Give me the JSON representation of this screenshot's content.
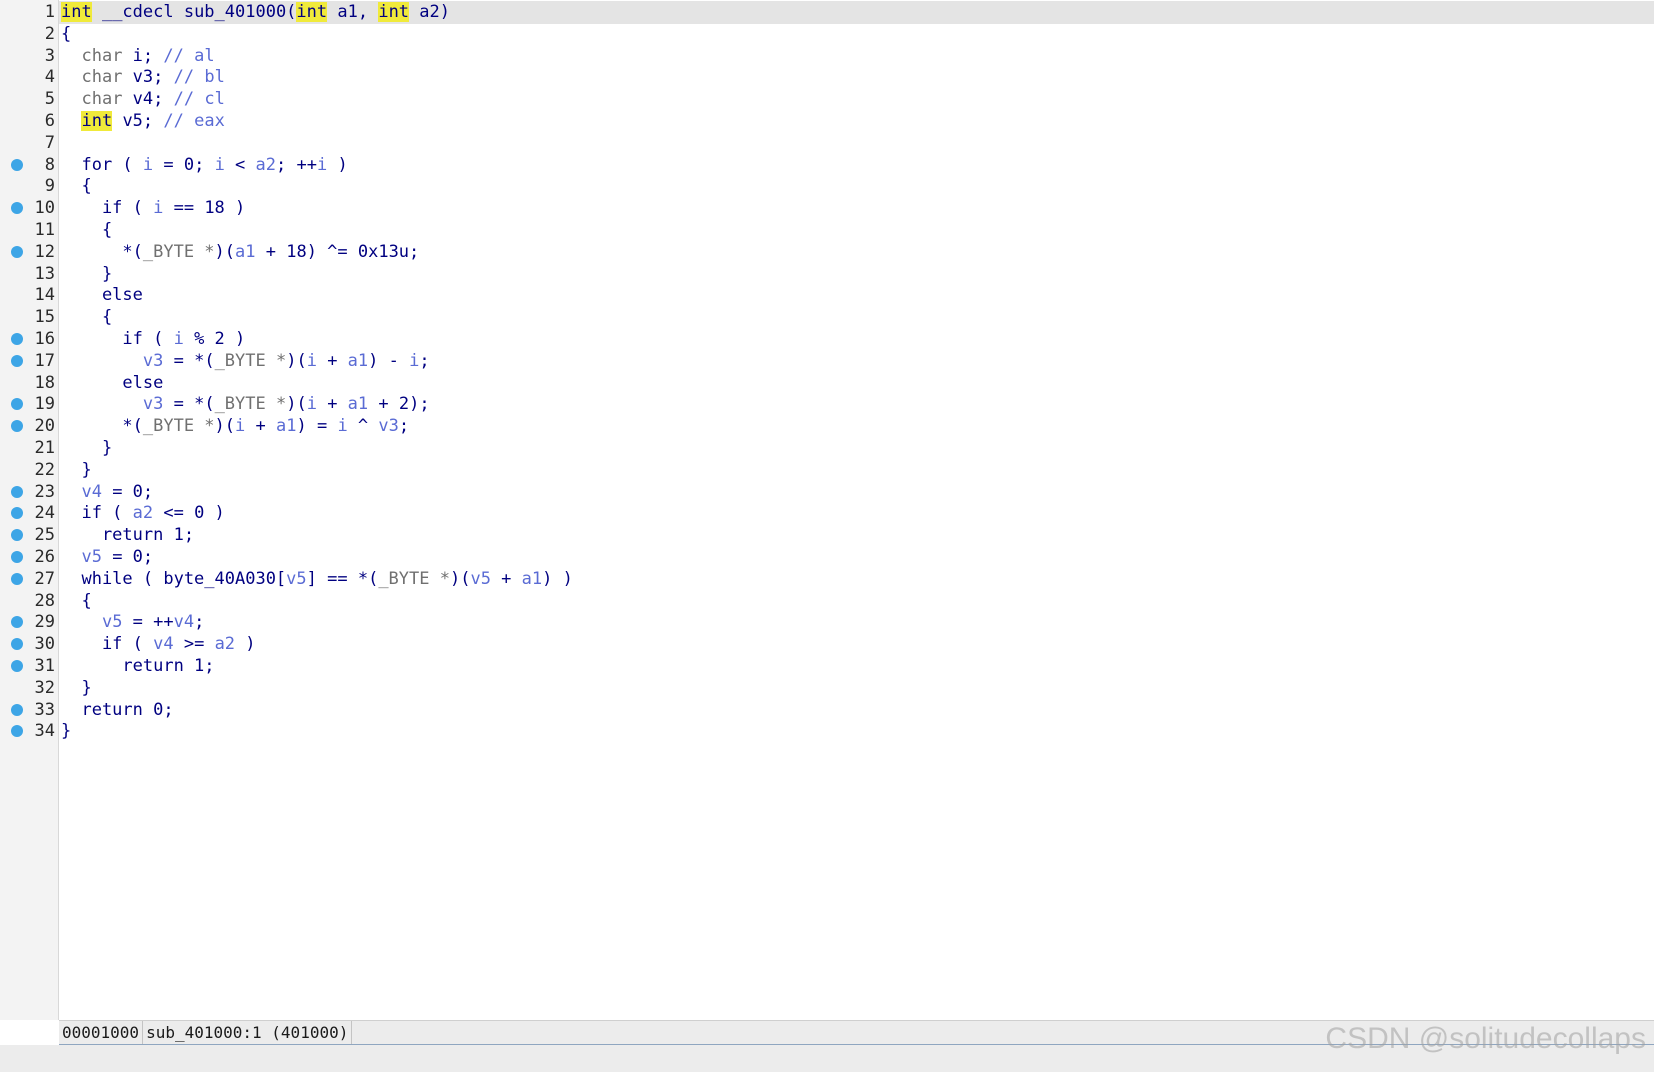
{
  "editor": {
    "current_line": 1,
    "lines": [
      {
        "n": "1",
        "bp": false,
        "tokens": [
          [
            "hl",
            "int"
          ],
          [
            "p",
            " __cdecl sub_401000("
          ],
          [
            "hl",
            "int"
          ],
          [
            "p",
            " a1, "
          ],
          [
            "hl",
            "int"
          ],
          [
            "p",
            " a2)"
          ]
        ]
      },
      {
        "n": "2",
        "bp": false,
        "tokens": [
          [
            "p",
            "{"
          ]
        ]
      },
      {
        "n": "3",
        "bp": false,
        "tokens": [
          [
            "p",
            "  "
          ],
          [
            "g",
            "char"
          ],
          [
            "p",
            " i; "
          ],
          [
            "c",
            "// al"
          ]
        ]
      },
      {
        "n": "4",
        "bp": false,
        "tokens": [
          [
            "p",
            "  "
          ],
          [
            "g",
            "char"
          ],
          [
            "p",
            " v3; "
          ],
          [
            "c",
            "// bl"
          ]
        ]
      },
      {
        "n": "5",
        "bp": false,
        "tokens": [
          [
            "p",
            "  "
          ],
          [
            "g",
            "char"
          ],
          [
            "p",
            " v4; "
          ],
          [
            "c",
            "// cl"
          ]
        ]
      },
      {
        "n": "6",
        "bp": false,
        "tokens": [
          [
            "p",
            "  "
          ],
          [
            "hl",
            "int"
          ],
          [
            "p",
            " v5; "
          ],
          [
            "c",
            "// eax"
          ]
        ]
      },
      {
        "n": "7",
        "bp": false,
        "tokens": [
          [
            "p",
            ""
          ]
        ]
      },
      {
        "n": "8",
        "bp": true,
        "tokens": [
          [
            "p",
            "  for ( "
          ],
          [
            "v",
            "i"
          ],
          [
            "p",
            " = 0; "
          ],
          [
            "v",
            "i"
          ],
          [
            "p",
            " < "
          ],
          [
            "v",
            "a2"
          ],
          [
            "p",
            "; ++"
          ],
          [
            "v",
            "i"
          ],
          [
            "p",
            " )"
          ]
        ]
      },
      {
        "n": "9",
        "bp": false,
        "tokens": [
          [
            "p",
            "  {"
          ]
        ]
      },
      {
        "n": "10",
        "bp": true,
        "tokens": [
          [
            "p",
            "    if ( "
          ],
          [
            "v",
            "i"
          ],
          [
            "p",
            " == 18 )"
          ]
        ]
      },
      {
        "n": "11",
        "bp": false,
        "tokens": [
          [
            "p",
            "    {"
          ]
        ]
      },
      {
        "n": "12",
        "bp": true,
        "tokens": [
          [
            "p",
            "      *("
          ],
          [
            "g",
            "_BYTE *"
          ],
          [
            "p",
            ")("
          ],
          [
            "v",
            "a1"
          ],
          [
            "p",
            " + 18) ^= 0x13u;"
          ]
        ]
      },
      {
        "n": "13",
        "bp": false,
        "tokens": [
          [
            "p",
            "    }"
          ]
        ]
      },
      {
        "n": "14",
        "bp": false,
        "tokens": [
          [
            "p",
            "    else"
          ]
        ]
      },
      {
        "n": "15",
        "bp": false,
        "tokens": [
          [
            "p",
            "    {"
          ]
        ]
      },
      {
        "n": "16",
        "bp": true,
        "tokens": [
          [
            "p",
            "      if ( "
          ],
          [
            "v",
            "i"
          ],
          [
            "p",
            " % 2 )"
          ]
        ]
      },
      {
        "n": "17",
        "bp": true,
        "tokens": [
          [
            "p",
            "        "
          ],
          [
            "v",
            "v3"
          ],
          [
            "p",
            " = *("
          ],
          [
            "g",
            "_BYTE *"
          ],
          [
            "p",
            ")("
          ],
          [
            "v",
            "i"
          ],
          [
            "p",
            " + "
          ],
          [
            "v",
            "a1"
          ],
          [
            "p",
            ") - "
          ],
          [
            "v",
            "i"
          ],
          [
            "p",
            ";"
          ]
        ]
      },
      {
        "n": "18",
        "bp": false,
        "tokens": [
          [
            "p",
            "      else"
          ]
        ]
      },
      {
        "n": "19",
        "bp": true,
        "tokens": [
          [
            "p",
            "        "
          ],
          [
            "v",
            "v3"
          ],
          [
            "p",
            " = *("
          ],
          [
            "g",
            "_BYTE *"
          ],
          [
            "p",
            ")("
          ],
          [
            "v",
            "i"
          ],
          [
            "p",
            " + "
          ],
          [
            "v",
            "a1"
          ],
          [
            "p",
            " + 2);"
          ]
        ]
      },
      {
        "n": "20",
        "bp": true,
        "tokens": [
          [
            "p",
            "      *("
          ],
          [
            "g",
            "_BYTE *"
          ],
          [
            "p",
            ")("
          ],
          [
            "v",
            "i"
          ],
          [
            "p",
            " + "
          ],
          [
            "v",
            "a1"
          ],
          [
            "p",
            ") = "
          ],
          [
            "v",
            "i"
          ],
          [
            "p",
            " ^ "
          ],
          [
            "v",
            "v3"
          ],
          [
            "p",
            ";"
          ]
        ]
      },
      {
        "n": "21",
        "bp": false,
        "tokens": [
          [
            "p",
            "    }"
          ]
        ]
      },
      {
        "n": "22",
        "bp": false,
        "tokens": [
          [
            "p",
            "  }"
          ]
        ]
      },
      {
        "n": "23",
        "bp": true,
        "tokens": [
          [
            "p",
            "  "
          ],
          [
            "v",
            "v4"
          ],
          [
            "p",
            " = 0;"
          ]
        ]
      },
      {
        "n": "24",
        "bp": true,
        "tokens": [
          [
            "p",
            "  if ( "
          ],
          [
            "v",
            "a2"
          ],
          [
            "p",
            " <= 0 )"
          ]
        ]
      },
      {
        "n": "25",
        "bp": true,
        "tokens": [
          [
            "p",
            "    return 1;"
          ]
        ]
      },
      {
        "n": "26",
        "bp": true,
        "tokens": [
          [
            "p",
            "  "
          ],
          [
            "v",
            "v5"
          ],
          [
            "p",
            " = 0;"
          ]
        ]
      },
      {
        "n": "27",
        "bp": true,
        "tokens": [
          [
            "p",
            "  while ( byte_40A030["
          ],
          [
            "v",
            "v5"
          ],
          [
            "p",
            "] == *("
          ],
          [
            "g",
            "_BYTE *"
          ],
          [
            "p",
            ")("
          ],
          [
            "v",
            "v5"
          ],
          [
            "p",
            " + "
          ],
          [
            "v",
            "a1"
          ],
          [
            "p",
            ") )"
          ]
        ]
      },
      {
        "n": "28",
        "bp": false,
        "tokens": [
          [
            "p",
            "  {"
          ]
        ]
      },
      {
        "n": "29",
        "bp": true,
        "tokens": [
          [
            "p",
            "    "
          ],
          [
            "v",
            "v5"
          ],
          [
            "p",
            " = ++"
          ],
          [
            "v",
            "v4"
          ],
          [
            "p",
            ";"
          ]
        ]
      },
      {
        "n": "30",
        "bp": true,
        "tokens": [
          [
            "p",
            "    if ( "
          ],
          [
            "v",
            "v4"
          ],
          [
            "p",
            " >= "
          ],
          [
            "v",
            "a2"
          ],
          [
            "p",
            " )"
          ]
        ]
      },
      {
        "n": "31",
        "bp": true,
        "tokens": [
          [
            "p",
            "      return 1;"
          ]
        ]
      },
      {
        "n": "32",
        "bp": false,
        "tokens": [
          [
            "p",
            "  }"
          ]
        ]
      },
      {
        "n": "33",
        "bp": true,
        "tokens": [
          [
            "p",
            "  return 0;"
          ]
        ]
      },
      {
        "n": "34",
        "bp": true,
        "tokens": [
          [
            "p",
            "}"
          ]
        ]
      }
    ]
  },
  "status": {
    "address": "00001000",
    "location": "sub_401000:1 (401000)"
  },
  "watermark": "CSDN @solitudecollaps",
  "colors": {
    "keyword": "#000080",
    "variable": "#5a6bd4",
    "highlight": "#f0ea3a",
    "breakpoint": "#3da5e6",
    "current_line": "#e4e4e4"
  }
}
